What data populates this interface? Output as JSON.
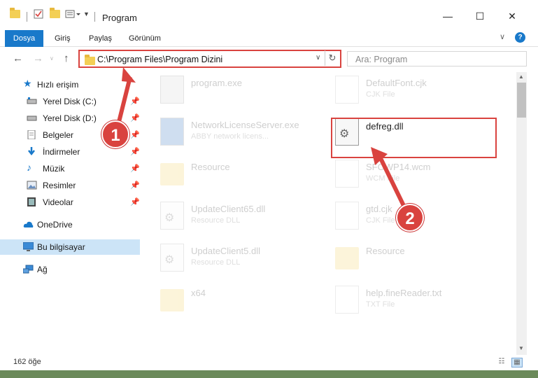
{
  "window": {
    "title": "Program",
    "controls": {
      "minimize": "—",
      "maximize": "☐",
      "close": "✕"
    }
  },
  "ribbon": {
    "tabs": [
      {
        "label": "Dosya"
      },
      {
        "label": "Giriş"
      },
      {
        "label": "Paylaş"
      },
      {
        "label": "Görünüm"
      }
    ],
    "help": "?"
  },
  "address_bar": {
    "path": "C:\\Program Files\\Program Dizini",
    "search_placeholder": "Ara: Program"
  },
  "sidebar": {
    "items": [
      {
        "label": "Hızlı erişim",
        "icon": "star-icon",
        "pinned": false
      },
      {
        "label": "Yerel Disk (C:)",
        "icon": "drive-icon",
        "pinned": true
      },
      {
        "label": "Yerel Disk (D:)",
        "icon": "drive-icon",
        "pinned": true
      },
      {
        "label": "Belgeler",
        "icon": "documents-icon",
        "pinned": true
      },
      {
        "label": "İndirmeler",
        "icon": "download-icon",
        "pinned": true
      },
      {
        "label": "Müzik",
        "icon": "music-icon",
        "pinned": true
      },
      {
        "label": "Resimler",
        "icon": "pictures-icon",
        "pinned": true
      },
      {
        "label": "Videolar",
        "icon": "video-icon",
        "pinned": true
      },
      {
        "label": "OneDrive",
        "icon": "cloud-icon",
        "pinned": false
      },
      {
        "label": "Bu bilgisayar",
        "icon": "computer-icon",
        "pinned": false,
        "selected": true
      },
      {
        "label": "Ağ",
        "icon": "network-icon",
        "pinned": false
      }
    ]
  },
  "files": [
    {
      "name": "program.exe",
      "type": "",
      "kind": "exe",
      "faded": true
    },
    {
      "name": "DefaultFont.cjk",
      "type": "CJK File",
      "kind": "doc",
      "faded": true
    },
    {
      "name": "NetworkLicenseServer.exe",
      "type": "ABBY network licens...",
      "kind": "exe",
      "faded": true
    },
    {
      "name": "defreg.dll",
      "type": "",
      "kind": "dll",
      "faded": false
    },
    {
      "name": "Resource",
      "type": "",
      "kind": "folder",
      "faded": true
    },
    {
      "name": "SFOWP14.wcm",
      "type": "WCM File",
      "kind": "doc",
      "faded": true
    },
    {
      "name": "UpdateClient65.dll",
      "type": "Resource DLL",
      "kind": "dll",
      "faded": true
    },
    {
      "name": "gtd.cjk",
      "type": "CJK File",
      "kind": "doc",
      "faded": true
    },
    {
      "name": "UpdateClient5.dll",
      "type": "Resource DLL",
      "kind": "dll",
      "faded": true
    },
    {
      "name": "Resource",
      "type": "",
      "kind": "folder",
      "faded": true
    },
    {
      "name": "x64",
      "type": "",
      "kind": "folder",
      "faded": true
    },
    {
      "name": "help.fineReader.txt",
      "type": "TXT File",
      "kind": "doc",
      "faded": true
    }
  ],
  "status": {
    "item_count": "162 öğe"
  },
  "annotations": {
    "step1": "1",
    "step2": "2",
    "accent": "#d9433f"
  }
}
